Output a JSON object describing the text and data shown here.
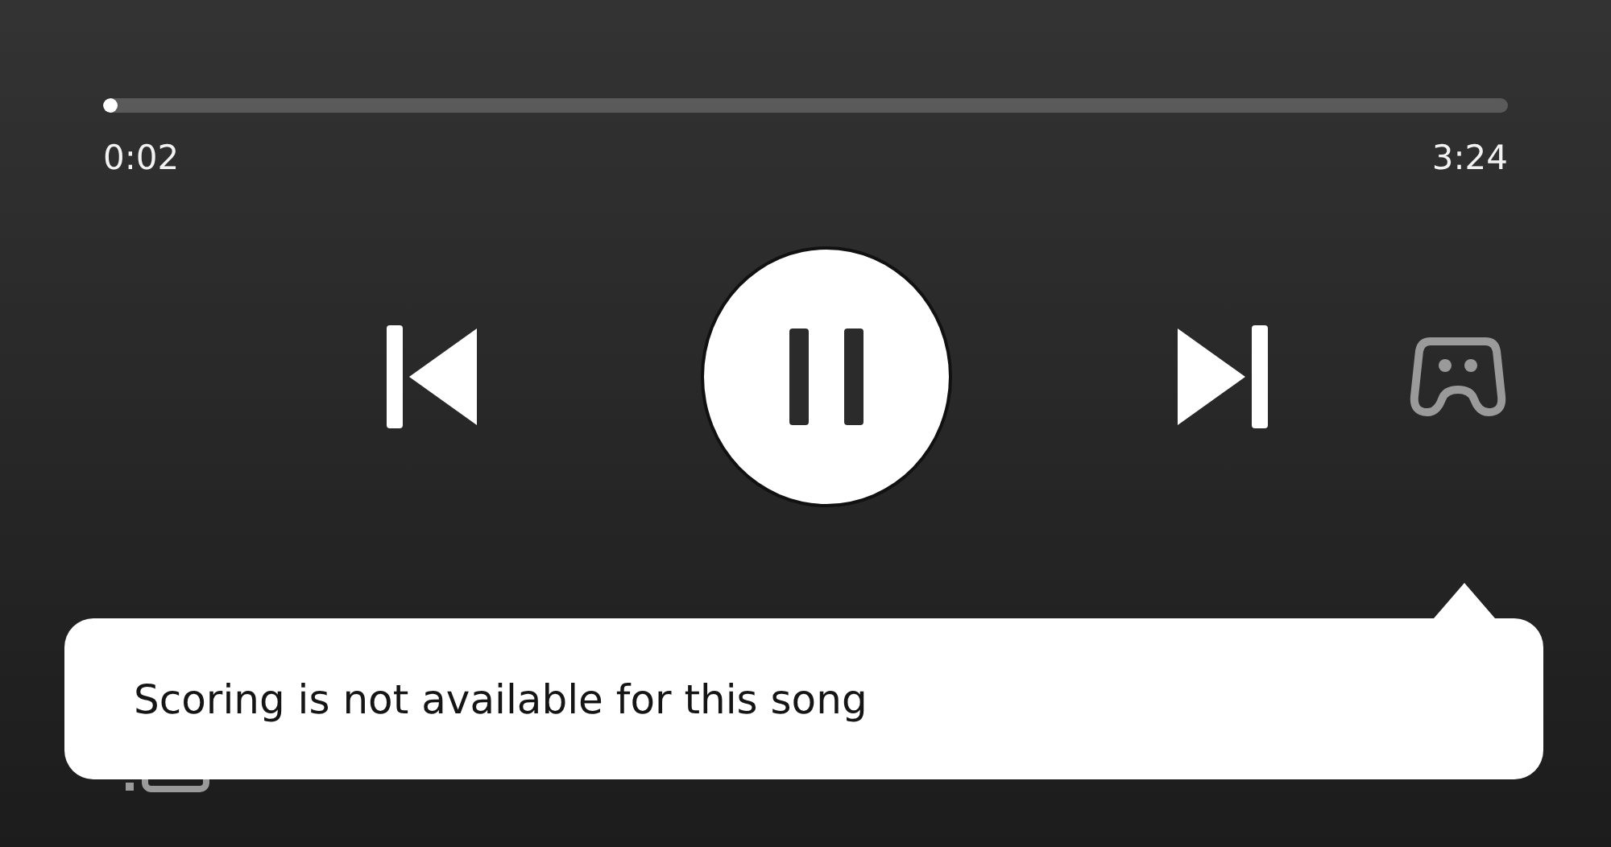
{
  "progress": {
    "level": 0.01,
    "elapsed": "0:02",
    "duration": "3:24"
  },
  "controls": {
    "playing": true
  },
  "toast": {
    "message": "Scoring is not available for this song"
  }
}
